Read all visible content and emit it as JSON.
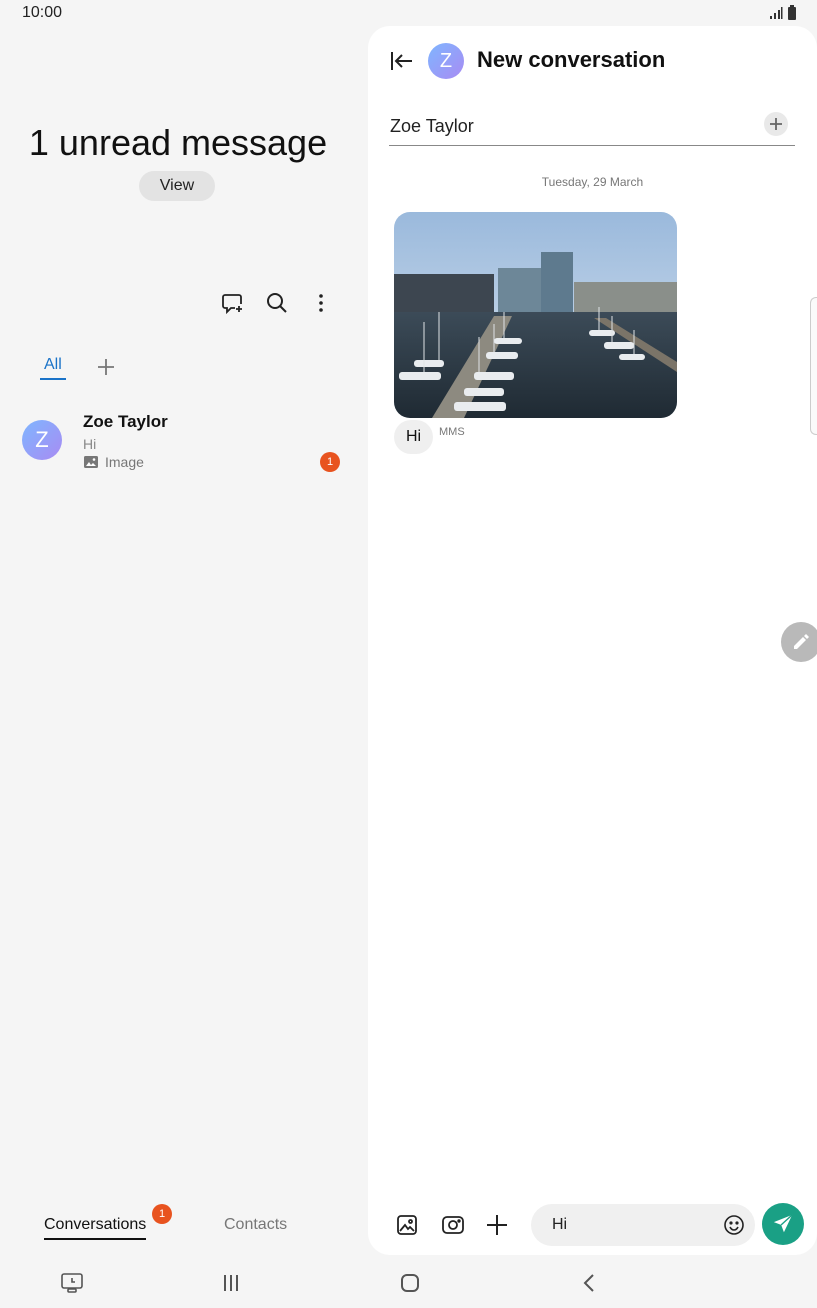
{
  "status_bar": {
    "time": "10:00",
    "icons": [
      "signal-icon",
      "battery-icon"
    ]
  },
  "left_pane": {
    "unread_title": "1 unread message",
    "view_button": "View",
    "toolbar_icons": [
      "new-chat-icon",
      "search-icon",
      "more-options-icon"
    ],
    "tabs": {
      "all": "All"
    },
    "conversation": {
      "avatar_letter": "Z",
      "name": "Zoe Taylor",
      "preview": "Hi",
      "attachment": "Image",
      "unread_count": "1"
    },
    "bottom_tabs": {
      "conversations": "Conversations",
      "conversations_badge": "1",
      "contacts": "Contacts"
    }
  },
  "right_pane": {
    "header": {
      "avatar_letter": "Z",
      "title": "New conversation"
    },
    "recipient": "Zoe Taylor",
    "date_separator": "Tuesday, 29 March",
    "message": {
      "text": "Hi",
      "tag": "MMS"
    },
    "composer": {
      "text": "Hi"
    }
  },
  "colors": {
    "accent": "#1a73c8",
    "badge": "#e8531f",
    "send": "#1aa085",
    "avatar_from": "#7fb6ff",
    "avatar_to": "#a88bf3"
  }
}
